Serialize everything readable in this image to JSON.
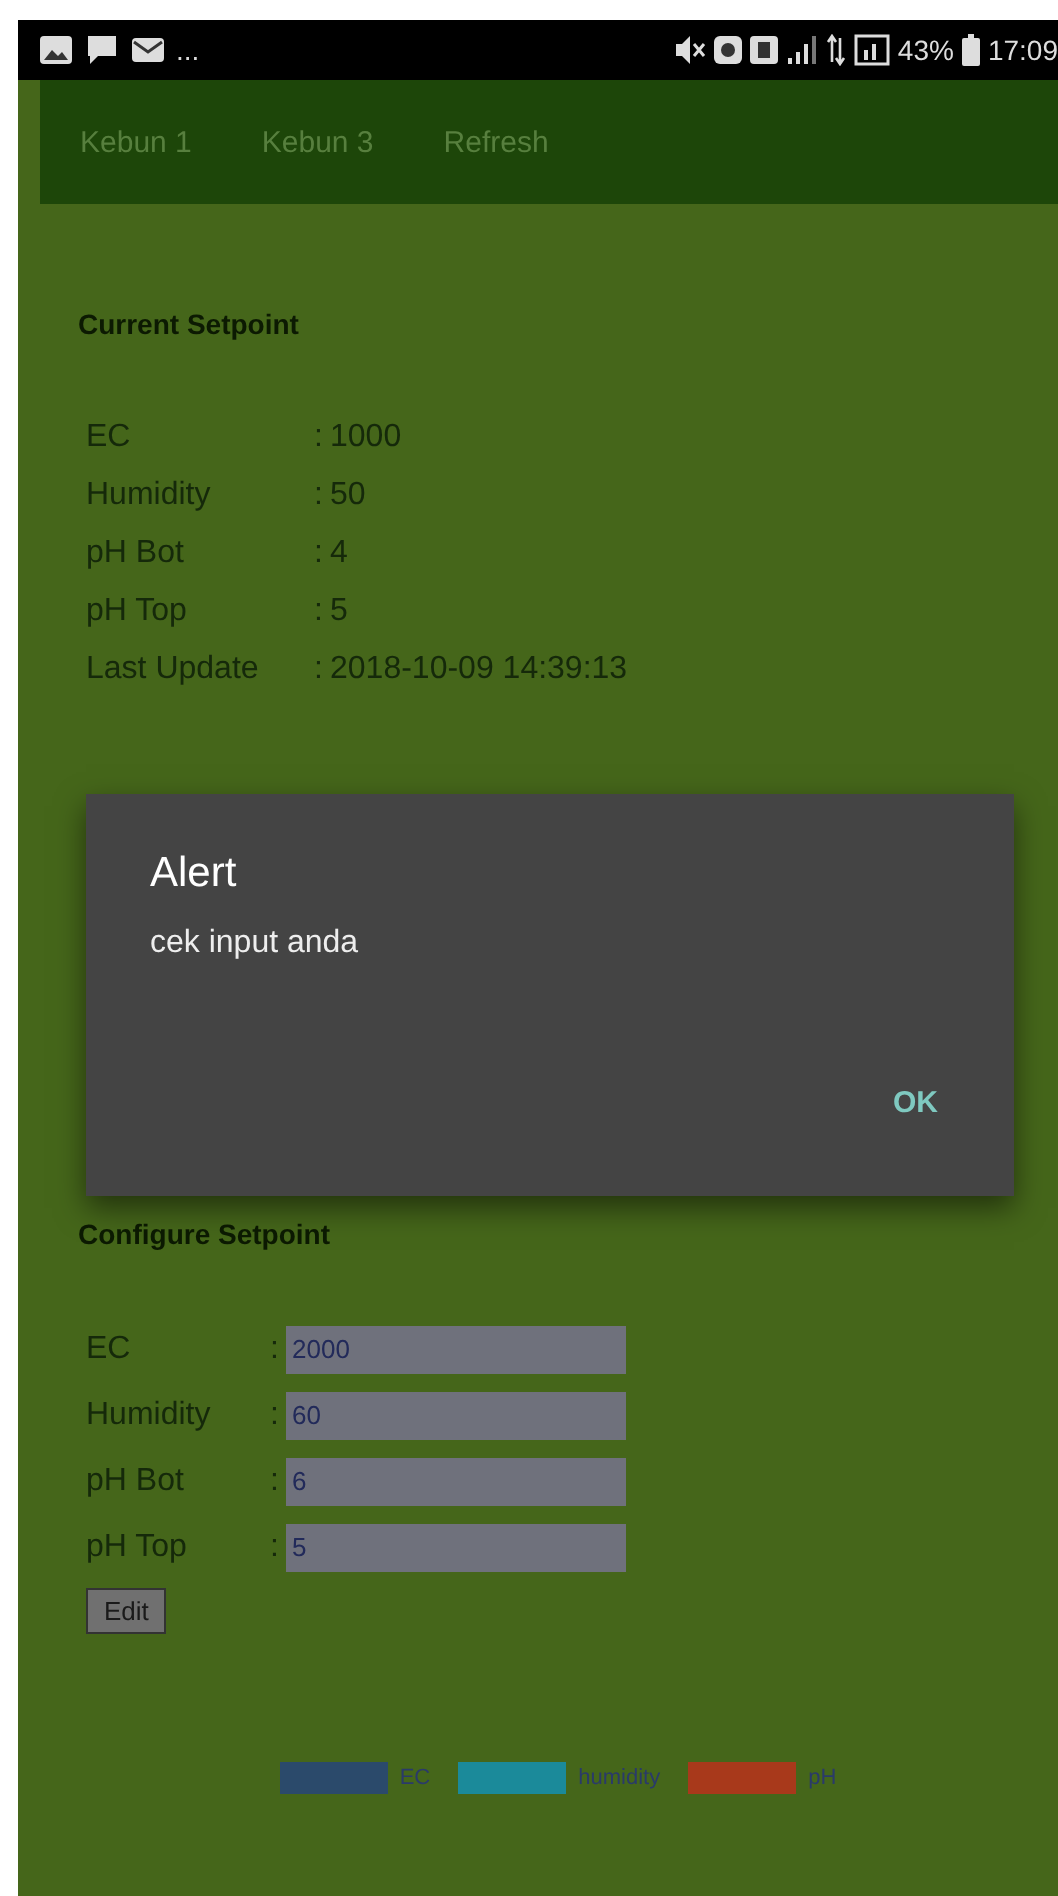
{
  "status_bar": {
    "overflow": "...",
    "battery": "43%",
    "time": "17:09"
  },
  "nav": [
    {
      "label": "Kebun 1"
    },
    {
      "label": "Kebun 3"
    },
    {
      "label": "Refresh"
    }
  ],
  "current": {
    "title": "Current Setpoint",
    "rows": [
      {
        "label": "EC",
        "separator": ":",
        "value": "1000"
      },
      {
        "label": "Humidity",
        "separator": ":",
        "value": "50"
      },
      {
        "label": "pH Bot",
        "separator": ":",
        "value": "4"
      },
      {
        "label": "pH Top",
        "separator": ":",
        "value": "5"
      },
      {
        "label": "Last Update",
        "separator": ":",
        "value": "2018-10-09 14:39:13"
      }
    ]
  },
  "dialog": {
    "title": "Alert",
    "message": "cek input anda",
    "button": "OK"
  },
  "configure": {
    "title": "Configure Setpoint",
    "fields": [
      {
        "label": "EC",
        "separator": ":",
        "value": "2000"
      },
      {
        "label": "Humidity",
        "separator": ":",
        "value": "60"
      },
      {
        "label": "pH Bot",
        "separator": ":",
        "value": "6"
      },
      {
        "label": "pH Top",
        "separator": ":",
        "value": "5"
      }
    ],
    "button": "Edit"
  },
  "legend": [
    {
      "label": "EC",
      "color": "#2b4a6b"
    },
    {
      "label": "humidity",
      "color": "#1b8a9a"
    },
    {
      "label": "pH",
      "color": "#a8391b"
    }
  ]
}
